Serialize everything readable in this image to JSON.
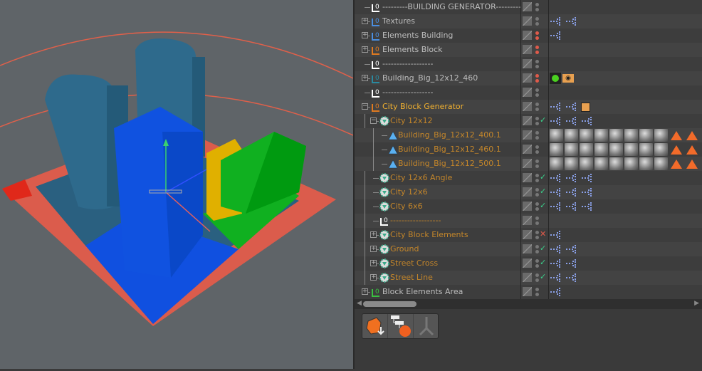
{
  "object_manager": {
    "rows": [
      {
        "label": "---------BUILDING GENERATOR---------",
        "level": 0,
        "expander": "none",
        "icon": "null-icon",
        "icon_color": "#ffffff",
        "text_color": "#bdbdbd",
        "dots": [
          "#777",
          "#777"
        ],
        "check": "",
        "tags": []
      },
      {
        "label": "Textures",
        "level": 0,
        "expander": "plus",
        "icon": "null-icon",
        "icon_color": "#4a8ee0",
        "text_color": "#bdbdbd",
        "dots": [
          "#777",
          "#777"
        ],
        "check": "",
        "tags": [
          "xpresso",
          "xpresso"
        ]
      },
      {
        "label": "Elements Building",
        "level": 0,
        "expander": "plus",
        "icon": "null-icon",
        "icon_color": "#4a8ee0",
        "text_color": "#bdbdbd",
        "dots": [
          "#e05a4a",
          "#e05a4a"
        ],
        "check": "",
        "tags": [
          "xpresso"
        ]
      },
      {
        "label": "Elements Block",
        "level": 0,
        "expander": "plus",
        "icon": "null-icon",
        "icon_color": "#e07a20",
        "text_color": "#bdbdbd",
        "dots": [
          "#e05a4a",
          "#e05a4a"
        ],
        "check": "",
        "tags": []
      },
      {
        "label": "------------------",
        "level": 0,
        "expander": "none",
        "icon": "null-icon",
        "icon_color": "#ffffff",
        "text_color": "#bdbdbd",
        "dots": [
          "#777",
          "#777"
        ],
        "check": "",
        "tags": []
      },
      {
        "label": "Building_Big_12x12_460",
        "level": 0,
        "expander": "plus",
        "icon": "null-icon",
        "icon_color": "#2a8aa0",
        "text_color": "#bdbdbd",
        "dots": [
          "#e05a4a",
          "#e05a4a"
        ],
        "check": "",
        "tags": [
          "display",
          "eye"
        ]
      },
      {
        "label": "------------------",
        "level": 0,
        "expander": "none",
        "icon": "null-icon",
        "icon_color": "#ffffff",
        "text_color": "#bdbdbd",
        "dots": [
          "#777",
          "#777"
        ],
        "check": "",
        "tags": []
      },
      {
        "label": "City Block Generator",
        "level": 0,
        "expander": "minus",
        "icon": "null-icon",
        "icon_color": "#e07a20",
        "text_color": "#f0b030",
        "dots": [
          "#777",
          "#777"
        ],
        "check": "",
        "tags": [
          "xpresso",
          "xpresso",
          "note"
        ]
      },
      {
        "label": "City 12x12",
        "level": 1,
        "expander": "minus",
        "icon": "cloner-icon",
        "icon_color": "#3aaa8a",
        "text_color": "#c4862a",
        "dots": [
          "#777",
          "#777"
        ],
        "check": "check",
        "tags": [
          "xpresso",
          "xpresso",
          "xpresso"
        ]
      },
      {
        "label": "Building_Big_12x12_400.1",
        "level": 2,
        "expander": "none",
        "icon": "polygon-icon",
        "icon_color": "#5ab0f0",
        "text_color": "#c4862a",
        "dots": [
          "#777",
          "#777"
        ],
        "check": "",
        "tags": [
          "mat",
          "mat",
          "mat",
          "mat",
          "mat",
          "mat",
          "mat",
          "mat",
          "phong",
          "phong",
          "phong"
        ]
      },
      {
        "label": "Building_Big_12x12_460.1",
        "level": 2,
        "expander": "none",
        "icon": "polygon-icon",
        "icon_color": "#5ab0f0",
        "text_color": "#c4862a",
        "dots": [
          "#777",
          "#777"
        ],
        "check": "",
        "tags": [
          "mat",
          "mat",
          "mat",
          "mat",
          "mat",
          "mat",
          "mat",
          "mat",
          "phong",
          "phong",
          "phong"
        ]
      },
      {
        "label": "Building_Big_12x12_500.1",
        "level": 2,
        "expander": "none",
        "icon": "polygon-icon",
        "icon_color": "#5ab0f0",
        "text_color": "#c4862a",
        "dots": [
          "#777",
          "#777"
        ],
        "check": "",
        "tags": [
          "mat",
          "mat",
          "mat",
          "mat",
          "mat",
          "mat",
          "mat",
          "mat",
          "phong",
          "phong",
          "phong"
        ]
      },
      {
        "label": "City 12x6 Angle",
        "level": 1,
        "expander": "none",
        "icon": "cloner-icon",
        "icon_color": "#3aaa8a",
        "text_color": "#c4862a",
        "dots": [
          "#777",
          "#777"
        ],
        "check": "check",
        "tags": [
          "xpresso",
          "xpresso",
          "xpresso"
        ]
      },
      {
        "label": "City 12x6",
        "level": 1,
        "expander": "none",
        "icon": "cloner-icon",
        "icon_color": "#3aaa8a",
        "text_color": "#c4862a",
        "dots": [
          "#777",
          "#777"
        ],
        "check": "check",
        "tags": [
          "xpresso",
          "xpresso",
          "xpresso"
        ]
      },
      {
        "label": "City 6x6",
        "level": 1,
        "expander": "none",
        "icon": "cloner-icon",
        "icon_color": "#3aaa8a",
        "text_color": "#c4862a",
        "dots": [
          "#777",
          "#777"
        ],
        "check": "check",
        "tags": [
          "xpresso",
          "xpresso",
          "xpresso"
        ]
      },
      {
        "label": "------------------",
        "level": 1,
        "expander": "none",
        "icon": "null-icon",
        "icon_color": "#ffffff",
        "text_color": "#c4862a",
        "dots": [
          "#777",
          "#777"
        ],
        "check": "",
        "tags": []
      },
      {
        "label": "City Block Elements",
        "level": 1,
        "expander": "plus",
        "icon": "cloner-icon",
        "icon_color": "#3aaa8a",
        "text_color": "#c4862a",
        "dots": [
          "#777",
          "#777"
        ],
        "check": "cross",
        "tags": [
          "xpresso"
        ]
      },
      {
        "label": "Ground",
        "level": 1,
        "expander": "plus",
        "icon": "cloner-icon",
        "icon_color": "#3aaa8a",
        "text_color": "#c4862a",
        "dots": [
          "#777",
          "#777"
        ],
        "check": "check",
        "tags": [
          "xpresso",
          "xpresso"
        ]
      },
      {
        "label": "Street Cross",
        "level": 1,
        "expander": "plus",
        "icon": "cloner-icon",
        "icon_color": "#3aaa8a",
        "text_color": "#c4862a",
        "dots": [
          "#777",
          "#777"
        ],
        "check": "check",
        "tags": [
          "xpresso",
          "xpresso"
        ]
      },
      {
        "label": "Street Line",
        "level": 1,
        "expander": "plus",
        "icon": "cloner-icon",
        "icon_color": "#3aaa8a",
        "text_color": "#c4862a",
        "dots": [
          "#777",
          "#777"
        ],
        "check": "check",
        "tags": [
          "xpresso",
          "xpresso"
        ]
      },
      {
        "label": "Block Elements Area",
        "level": 0,
        "expander": "plus",
        "icon": "null-icon",
        "icon_color": "#3ac040",
        "text_color": "#bdbdbd",
        "dots": [
          "#777",
          "#777"
        ],
        "check": "",
        "tags": [
          "xpresso"
        ]
      }
    ]
  },
  "toolbar": {
    "buttons": [
      "connect-objects-delete-icon",
      "xpresso-node-icon",
      "skeleton-icon"
    ]
  },
  "colors": {
    "check": "#3ad08a",
    "cross": "#e05a4a",
    "xpresso": "#8aa0e8"
  }
}
